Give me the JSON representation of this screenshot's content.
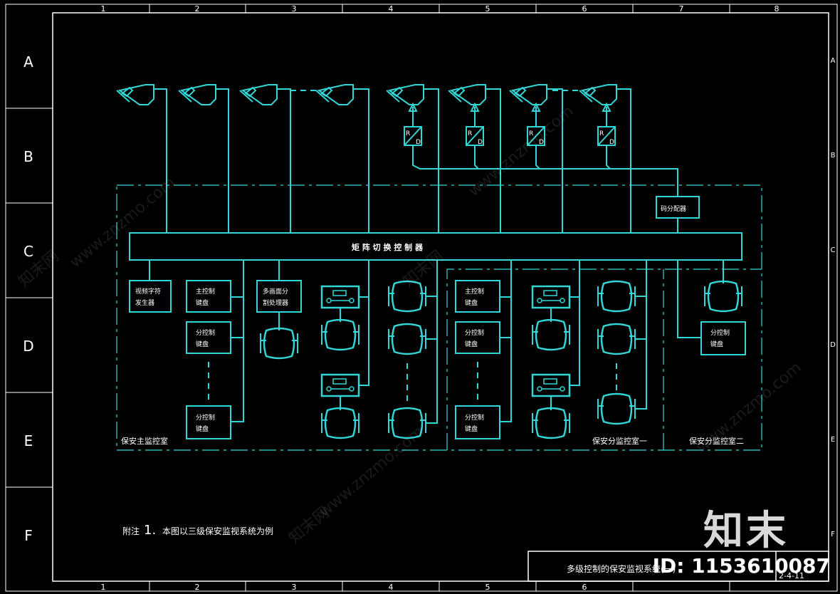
{
  "grid": {
    "columns": [
      "1",
      "2",
      "3",
      "4",
      "5",
      "6",
      "7",
      "8"
    ],
    "rows": [
      "A",
      "B",
      "C",
      "D",
      "E",
      "F"
    ]
  },
  "labels": {
    "matrix_switcher": "矩 阵 切 换 控 制 器",
    "distributor": "码分配器",
    "rd": [
      "R",
      "D"
    ],
    "main_room": "保安主监控室",
    "sub_room_1": "保安分监控室一",
    "sub_room_2": "保安分监控室二",
    "alarm_1": "视频字符",
    "alarm_2": "发生器",
    "main_kb_1": "主控制",
    "main_kb_2": "键盘",
    "sub_kb_1": "分控制",
    "sub_kb_2": "键盘",
    "multi_1": "多画面分",
    "multi_2": "割处理器"
  },
  "note": {
    "prefix": "附注",
    "number": "1.",
    "text": "本图以三级保安监视系统为例"
  },
  "title_block": {
    "title": "多级控制的保安监视系统(一)",
    "code": "2-4-11"
  },
  "watermark": {
    "brand": "知末",
    "id": "ID: 1153610087",
    "site": "www.znzmo.com",
    "site_cn": "知末网"
  },
  "colors": {
    "line": "#33d6d6",
    "frame": "#ffffff",
    "bg": "#000000"
  }
}
